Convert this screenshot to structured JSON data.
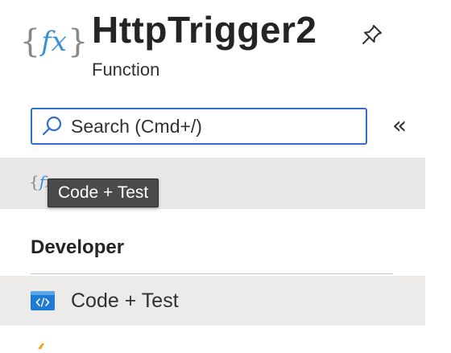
{
  "header": {
    "title": "HttpTrigger2",
    "subtitle": "Function",
    "logo_icon": "function-fx-icon",
    "pin_icon": "pin-icon"
  },
  "search": {
    "placeholder": "Search (Cmd+/)",
    "icon": "search-icon"
  },
  "collapse_label": "«",
  "tooltip": {
    "text": "Code + Test"
  },
  "sections": [
    {
      "header": "Developer",
      "items": [
        {
          "label": "Code + Test",
          "icon": "code-icon"
        }
      ]
    }
  ],
  "colors": {
    "accent": "#2f6fcb",
    "fx_blue": "#3b8fd9",
    "fx_gray": "#8a8886",
    "code_icon_blue": "#1f7ad4",
    "hover_bg": "#e9e8e7",
    "tooltip_bg": "#4a4a4a",
    "peek_orange": "#f7a21b"
  }
}
